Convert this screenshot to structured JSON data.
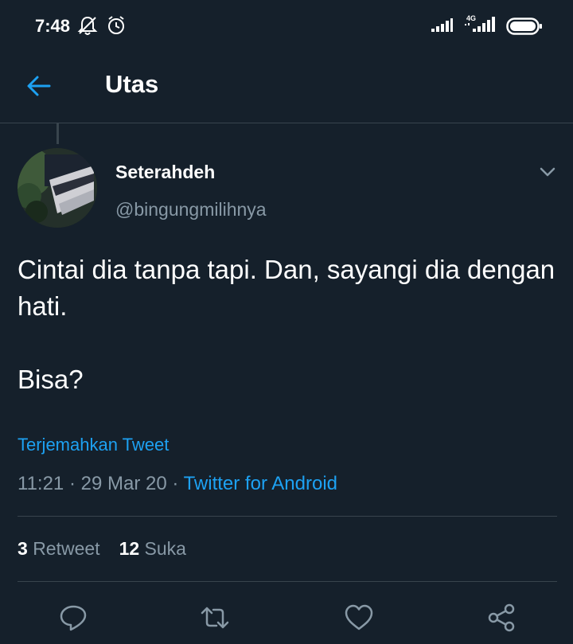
{
  "status_bar": {
    "time": "7:48",
    "network": "4G",
    "icons": [
      "notifications-muted-icon",
      "alarm-icon",
      "signal-icon",
      "signal-4g-icon",
      "battery-icon"
    ]
  },
  "header": {
    "title": "Utas",
    "back_icon": "arrow-left-icon"
  },
  "tweet": {
    "author_name": "Seterahdeh",
    "author_handle": "@bingungmilihnya",
    "text": "Cintai dia tanpa tapi. Dan, sayangi dia dengan hati.\n\nBisa?",
    "translate_label": "Terjemahkan Tweet",
    "time": "11:21",
    "separator": " · ",
    "date": "29 Mar 20",
    "source": "Twitter for Android",
    "retweet_count": "3",
    "retweet_label": "Retweet",
    "like_count": "12",
    "like_label": "Suka"
  },
  "actions": [
    "reply-icon",
    "retweet-icon",
    "like-icon",
    "share-icon"
  ],
  "colors": {
    "background": "#15202b",
    "accent": "#1da1f2",
    "secondary_text": "#8899a6",
    "divider": "#38444d"
  }
}
